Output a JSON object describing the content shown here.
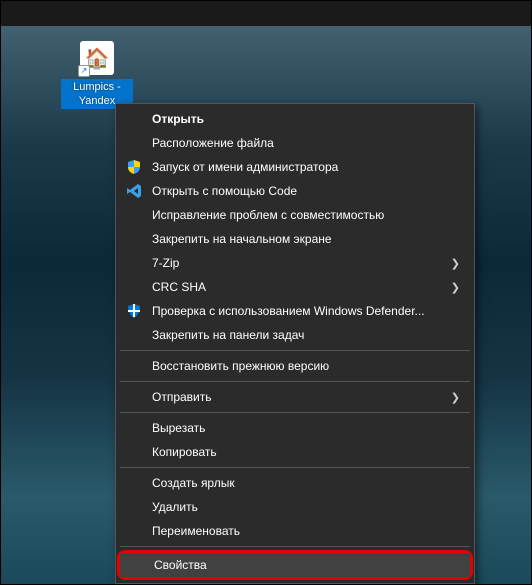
{
  "desktop_icon": {
    "label": "Lumpics - Yandex",
    "glyph": "🏠"
  },
  "context_menu": {
    "open": "Открыть",
    "file_location": "Расположение файла",
    "run_as_admin": "Запуск от имени администратора",
    "open_with_code": "Открыть с помощью Code",
    "troubleshoot_compat": "Исправление проблем с совместимостью",
    "pin_to_start": "Закрепить на начальном экране",
    "sevenzip": "7-Zip",
    "crc_sha": "CRC SHA",
    "scan_defender": "Проверка с использованием Windows Defender...",
    "pin_to_taskbar": "Закрепить на панели задач",
    "restore_previous": "Восстановить прежнюю версию",
    "send_to": "Отправить",
    "cut": "Вырезать",
    "copy": "Копировать",
    "create_shortcut": "Создать ярлык",
    "delete": "Удалить",
    "rename": "Переименовать",
    "properties": "Свойства"
  }
}
